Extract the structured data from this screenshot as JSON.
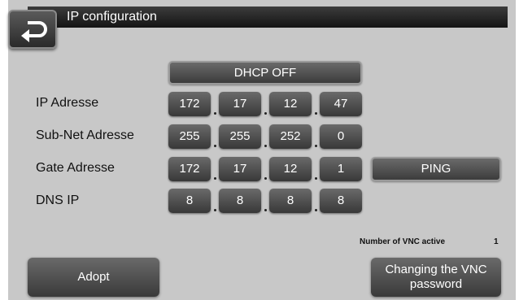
{
  "header": {
    "title": "IP configuration"
  },
  "dhcp_button": "DHCP OFF",
  "rows": [
    {
      "label": "IP Adresse",
      "octets": [
        "172",
        "17",
        "12",
        "47"
      ]
    },
    {
      "label": "Sub-Net Adresse",
      "octets": [
        "255",
        "255",
        "252",
        "0"
      ]
    },
    {
      "label": "Gate Adresse",
      "octets": [
        "172",
        "17",
        "12",
        "1"
      ]
    },
    {
      "label": "DNS IP",
      "octets": [
        "8",
        "8",
        "8",
        "8"
      ]
    }
  ],
  "ping_button": "PING",
  "vnc": {
    "label": "Number of VNC active",
    "count": "1"
  },
  "buttons": {
    "adopt": "Adopt",
    "vnc_password_line1": "Changing the VNC",
    "vnc_password_line2": "password"
  },
  "icons": {
    "back": "return-arrow-icon"
  }
}
